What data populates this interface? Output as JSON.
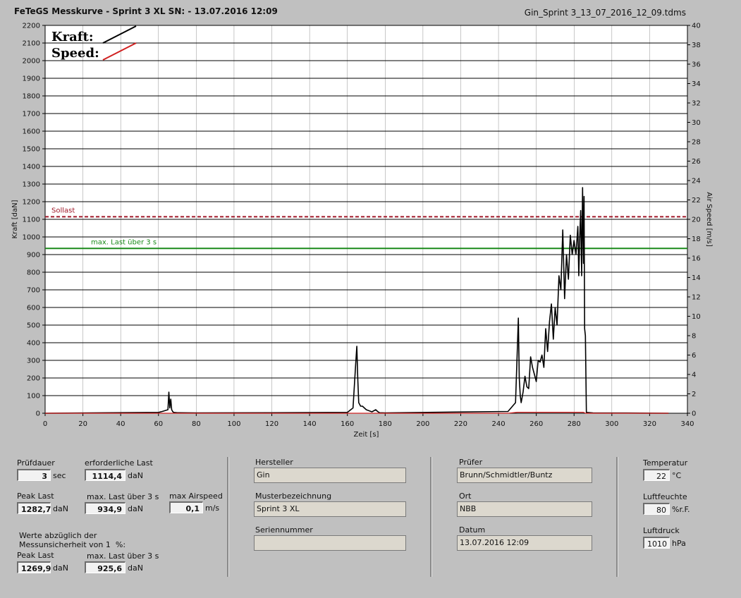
{
  "header": {
    "title": "FeTeGS Messkurve - Sprint 3 XL  SN:  - 13.07.2016 12:09",
    "file": "Gin_Sprint 3_13_07_2016_12_09.tdms"
  },
  "colors": {
    "kraft": "#000000",
    "speed": "#d02020",
    "solllast": "#a01828",
    "maxlast": "#1a8a1a"
  },
  "chart_data": {
    "type": "line",
    "xlabel": "Zeit [s]",
    "ylabel": "Kraft [daN]",
    "y2label": "Air Speed [m/s]",
    "xlim": [
      0,
      340
    ],
    "ylim": [
      0,
      2200
    ],
    "y2lim": [
      0,
      40
    ],
    "x_ticks": [
      0,
      20,
      40,
      60,
      80,
      100,
      120,
      140,
      160,
      180,
      200,
      220,
      240,
      260,
      280,
      300,
      320,
      340
    ],
    "y_ticks": [
      0,
      100,
      200,
      300,
      400,
      500,
      600,
      700,
      800,
      900,
      1000,
      1100,
      1200,
      1300,
      1400,
      1500,
      1600,
      1700,
      1800,
      1900,
      2000,
      2100,
      2200
    ],
    "y2_ticks": [
      0,
      2,
      4,
      6,
      8,
      10,
      12,
      14,
      16,
      18,
      20,
      22,
      24,
      26,
      28,
      30,
      32,
      34,
      36,
      38,
      40
    ],
    "grid": true,
    "legend": {
      "placement": "top-left",
      "entries": [
        "Kraft:",
        "Speed:"
      ]
    },
    "reference_lines": [
      {
        "label": "Sollast",
        "value": 1114.4,
        "style": "dashed",
        "color": "#a01828"
      },
      {
        "label": "max. Last über  3 s",
        "value": 934.9,
        "style": "solid",
        "color": "#1a8a1a"
      }
    ],
    "series": [
      {
        "name": "Kraft:",
        "axis": "left",
        "color": "#000000",
        "x": [
          0,
          60,
          62,
          65,
          65.5,
          66,
          66.5,
          67,
          67.5,
          68,
          70,
          80,
          120,
          160,
          163,
          164.5,
          165,
          165.5,
          166,
          167,
          168,
          170,
          173,
          175,
          176,
          177,
          180,
          245,
          249,
          250,
          250.5,
          251,
          251.5,
          252,
          253,
          254,
          255,
          256,
          257,
          258,
          259,
          260,
          261,
          262,
          263,
          264,
          265,
          266,
          267,
          268,
          269,
          270,
          271,
          272,
          273,
          274,
          275,
          276,
          277,
          278,
          279,
          280,
          281,
          282,
          282.5,
          283,
          283.5,
          284,
          284.5,
          285,
          285.3,
          285.6,
          286,
          286.5,
          290,
          330
        ],
        "y": [
          0,
          5,
          10,
          20,
          120,
          30,
          80,
          20,
          10,
          5,
          3,
          2,
          3,
          5,
          30,
          300,
          380,
          200,
          60,
          40,
          40,
          20,
          8,
          20,
          10,
          3,
          2,
          10,
          60,
          380,
          540,
          200,
          100,
          60,
          120,
          210,
          150,
          140,
          320,
          260,
          220,
          180,
          300,
          290,
          330,
          260,
          480,
          350,
          520,
          620,
          420,
          600,
          500,
          780,
          700,
          1040,
          650,
          900,
          760,
          1010,
          900,
          980,
          900,
          1060,
          780,
          1000,
          1150,
          780,
          1280,
          850,
          1230,
          480,
          440,
          5,
          2,
          0
        ]
      },
      {
        "name": "Speed:",
        "axis": "right",
        "color": "#d02020",
        "x": [
          0,
          245,
          250,
          260,
          270,
          280,
          285,
          286,
          330
        ],
        "y": [
          0,
          0,
          0.1,
          0.1,
          0.1,
          0.1,
          0.1,
          0,
          0
        ]
      }
    ]
  },
  "panel": {
    "pruefdauer": {
      "label": "Prüfdauer",
      "value": "3",
      "unit": "sec"
    },
    "erforderliche_last": {
      "label": "erforderliche Last",
      "value": "1114,4",
      "unit": "daN"
    },
    "peak_last": {
      "label": "Peak Last",
      "value": "1282,7",
      "unit": "daN"
    },
    "max_last": {
      "label": "max. Last über  3 s",
      "value": "934,9",
      "unit": "daN"
    },
    "max_airspeed": {
      "label": "max Airspeed",
      "value": "0,1",
      "unit": "m/s"
    },
    "werte_note": "Werte abzüglich der\nMessunsicherheit von 1  %:",
    "peak_last_2": {
      "label": "Peak Last",
      "value": "1269,9",
      "unit": "daN"
    },
    "max_last_2": {
      "label": "max. Last über  3 s",
      "value": "925,6",
      "unit": "daN"
    },
    "hersteller": {
      "label": "Hersteller",
      "value": "Gin"
    },
    "muster": {
      "label": "Musterbezeichnung",
      "value": "Sprint 3 XL"
    },
    "serien": {
      "label": "Seriennummer",
      "value": ""
    },
    "pruefer": {
      "label": "Prüfer",
      "value": "Brunn/Schmidtler/Buntz"
    },
    "ort": {
      "label": "Ort",
      "value": "NBB"
    },
    "datum": {
      "label": "Datum",
      "value": "13.07.2016 12:09"
    },
    "temperatur": {
      "label": "Temperatur",
      "value": "22",
      "unit": "°C"
    },
    "luftfeuchte": {
      "label": "Luftfeuchte",
      "value": "80",
      "unit": "%r.F."
    },
    "luftdruck": {
      "label": "Luftdruck",
      "value": "1010",
      "unit": "hPa"
    }
  }
}
